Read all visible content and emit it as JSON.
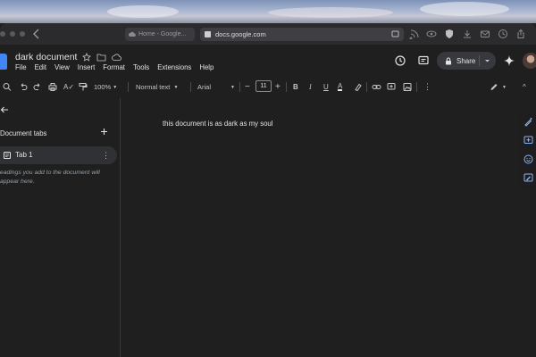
{
  "browser": {
    "tab_title": "Home - Google...",
    "address": "docs.google.com"
  },
  "doc": {
    "title": "dark document",
    "body_text": "this document is as dark as my soul"
  },
  "menu": [
    "File",
    "Edit",
    "View",
    "Insert",
    "Format",
    "Tools",
    "Extensions",
    "Help"
  ],
  "header": {
    "share_label": "Share"
  },
  "toolbar": {
    "zoom": "100%",
    "style": "Normal text",
    "font": "Arial",
    "font_size": "11"
  },
  "sidebar": {
    "section_label": "Document tabs",
    "tabs": [
      {
        "label": "Tab 1"
      }
    ],
    "hint": "Headings you add to the document will appear here."
  },
  "colors": {
    "background": "#1f1f1f",
    "docs_blue": "#4285f4",
    "text": "#e3e3e3"
  }
}
